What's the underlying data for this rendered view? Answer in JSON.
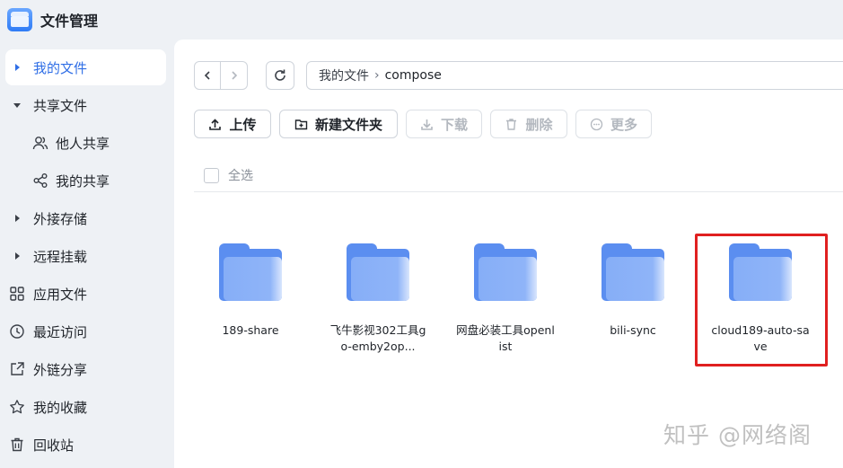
{
  "app": {
    "title": "文件管理",
    "icon": "file-manager-app-icon"
  },
  "sidebar": {
    "items": [
      {
        "label": "我的文件",
        "icon": "caret-right-icon",
        "active": true
      },
      {
        "label": "共享文件",
        "icon": "caret-down-icon"
      },
      {
        "label": "他人共享",
        "icon": "people-icon"
      },
      {
        "label": "我的共享",
        "icon": "share-icon"
      },
      {
        "label": "外接存储",
        "icon": "caret-right-icon"
      },
      {
        "label": "远程挂载",
        "icon": "caret-right-icon"
      },
      {
        "label": "应用文件",
        "icon": "apps-grid-icon"
      },
      {
        "label": "最近访问",
        "icon": "clock-icon"
      },
      {
        "label": "外链分享",
        "icon": "external-link-icon"
      },
      {
        "label": "我的收藏",
        "icon": "star-icon"
      },
      {
        "label": "回收站",
        "icon": "trash-icon"
      }
    ]
  },
  "breadcrumb": {
    "root": "我的文件",
    "separator": "›",
    "current": "compose"
  },
  "toolbar": {
    "upload": "上传",
    "new_folder": "新建文件夹",
    "download": "下载",
    "delete": "删除",
    "more": "更多"
  },
  "list": {
    "select_all": "全选",
    "files": [
      {
        "name": "189-share",
        "type": "folder"
      },
      {
        "name": "飞牛影视302工具go-emby2op...",
        "type": "folder"
      },
      {
        "name": "网盘必装工具openlist",
        "type": "folder"
      },
      {
        "name": "bili-sync",
        "type": "folder"
      },
      {
        "name": "cloud189-auto-save",
        "type": "folder",
        "highlighted": true
      }
    ]
  },
  "colors": {
    "accent": "#2f6ee6",
    "folder": "#5b8ef0",
    "highlight": "#e02020"
  },
  "watermark": "知乎 @网络阁"
}
